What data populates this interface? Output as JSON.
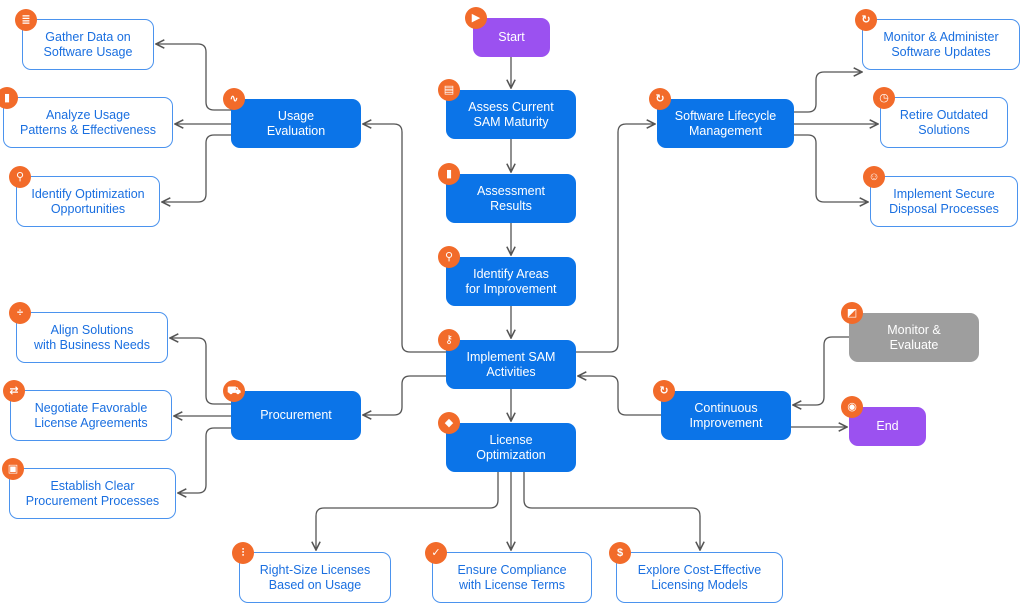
{
  "colors": {
    "primary": "#0b74e8",
    "start_end": "#9b51f0",
    "inactive": "#9e9e9e",
    "icon_badge": "#f26b2a",
    "outline_text": "#1a6fe0",
    "connector": "#555555"
  },
  "nodes": [
    {
      "id": "start",
      "label": "Start",
      "icon": "play-icon"
    },
    {
      "id": "assess",
      "label": "Assess Current\nSAM Maturity",
      "icon": "clipboard-icon"
    },
    {
      "id": "results",
      "label": "Assessment\nResults",
      "icon": "bar-chart-icon"
    },
    {
      "id": "identify-areas",
      "label": "Identify Areas\nfor Improvement",
      "icon": "search-icon"
    },
    {
      "id": "implement",
      "label": "Implement SAM\nActivities",
      "icon": "key-icon"
    },
    {
      "id": "license-opt",
      "label": "License\nOptimization",
      "icon": "tag-icon"
    },
    {
      "id": "usage",
      "label": "Usage\nEvaluation",
      "icon": "pulse-icon"
    },
    {
      "id": "procurement",
      "label": "Procurement",
      "icon": "cart-icon"
    },
    {
      "id": "lifecycle",
      "label": "Software Lifecycle\nManagement",
      "icon": "refresh-icon"
    },
    {
      "id": "continuous",
      "label": "Continuous\nImprovement",
      "icon": "refresh-icon"
    },
    {
      "id": "monitor-evaluate",
      "label": "Monitor &\nEvaluate",
      "icon": "monitor-chart-icon"
    },
    {
      "id": "end",
      "label": "End",
      "icon": "stop-icon"
    },
    {
      "id": "gather",
      "label": "Gather Data on\nSoftware Usage",
      "icon": "database-icon"
    },
    {
      "id": "analyze",
      "label": "Analyze Usage\nPatterns & Effectiveness",
      "icon": "bar-chart-icon"
    },
    {
      "id": "identify-opt",
      "label": "Identify Optimization\nOpportunities",
      "icon": "search-icon"
    },
    {
      "id": "align",
      "label": "Align Solutions\nwith Business Needs",
      "icon": "divide-icon"
    },
    {
      "id": "negotiate",
      "label": "Negotiate Favorable\nLicense Agreements",
      "icon": "handshake-icon"
    },
    {
      "id": "establish",
      "label": "Establish Clear\nProcurement Processes",
      "icon": "process-icon"
    },
    {
      "id": "monitor-admin",
      "label": "Monitor & Administer\nSoftware Updates",
      "icon": "refresh-icon"
    },
    {
      "id": "retire",
      "label": "Retire Outdated\nSolutions",
      "icon": "history-icon"
    },
    {
      "id": "dispose",
      "label": "Implement Secure\nDisposal Processes",
      "icon": "user-icon"
    },
    {
      "id": "rightsize",
      "label": "Right-Size Licenses\nBased on Usage",
      "icon": "sliders-icon"
    },
    {
      "id": "ensure",
      "label": "Ensure Compliance\nwith License Terms",
      "icon": "check-circle-icon"
    },
    {
      "id": "explore",
      "label": "Explore Cost-Effective\nLicensing Models",
      "icon": "dollar-icon"
    }
  ]
}
